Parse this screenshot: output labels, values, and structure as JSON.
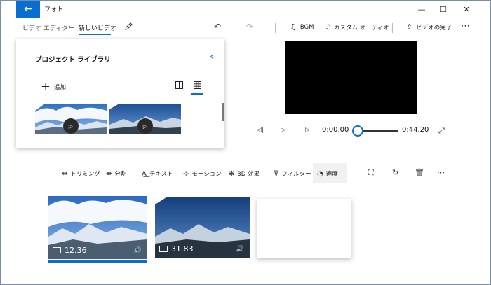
{
  "titlebar": {
    "app_title": "フォト",
    "back_icon": "back-arrow-icon",
    "minimize": "—",
    "maximize": "☐",
    "close": "✕"
  },
  "breadcrumb": {
    "parent": "ビデオ エディター",
    "separator": "›",
    "current": "新しいビデオ"
  },
  "command_bar": {
    "undo": "↶",
    "redo": "↷",
    "bgm": "BGM",
    "custom_audio": "カスタム オーディオ",
    "finish_video": "ビデオの完了",
    "more": "⋯"
  },
  "library": {
    "title": "プロジェクト ライブラリ",
    "add_label": "追加",
    "add_icon": "＋"
  },
  "player": {
    "current_time": "0:00.00",
    "total_time": "0:44.20",
    "progress": 0.0
  },
  "tools": {
    "trim": "トリミング",
    "split": "分割",
    "text": "テキスト",
    "motion": "モーション",
    "effects_3d": "3D 効果",
    "filters": "フィルター",
    "speed": "速度"
  },
  "storyboard": {
    "clips": [
      {
        "duration": "12.36"
      },
      {
        "duration": "31.83"
      }
    ]
  },
  "colors": {
    "accent": "#0a6ed1",
    "preview_bg": "#000000"
  }
}
